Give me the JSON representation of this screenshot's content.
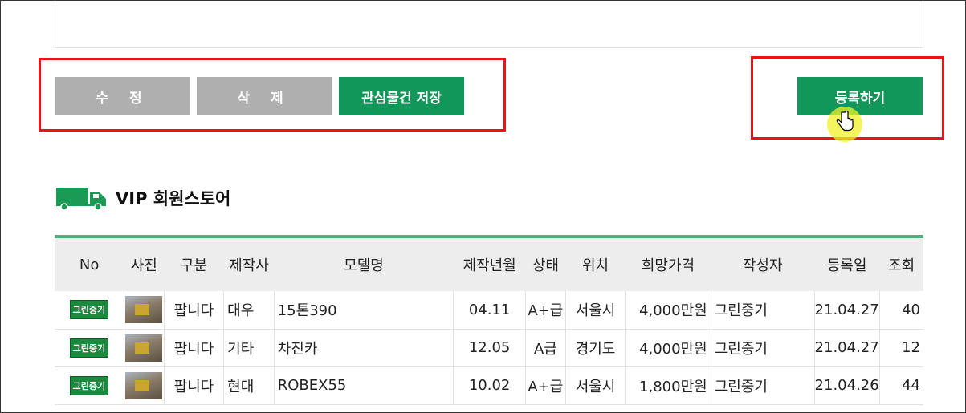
{
  "buttons": {
    "edit": "수 정",
    "delete": "삭 제",
    "save_interest": "관심물건 저장",
    "register": "등록하기"
  },
  "section": {
    "title": "VIP 회원스토어",
    "icon": "truck-icon"
  },
  "table": {
    "headers": [
      "No",
      "사진",
      "구분",
      "제작사",
      "모델명",
      "제작년월",
      "상태",
      "위치",
      "희망가격",
      "작성자",
      "등록일",
      "조회"
    ],
    "rows": [
      {
        "badge": "그린중기",
        "type": "팝니다",
        "maker": "대우",
        "model": "15톤390",
        "date": "04.11",
        "state": "A+급",
        "location": "서울시",
        "price": "4,000만원",
        "author": "그린중기",
        "reg": "21.04.27",
        "views": "40"
      },
      {
        "badge": "그린중기",
        "type": "팝니다",
        "maker": "기타",
        "model": "차진카",
        "date": "12.05",
        "state": "A급",
        "location": "경기도",
        "price": "4,000만원",
        "author": "그린중기",
        "reg": "21.04.27",
        "views": "12"
      },
      {
        "badge": "그린중기",
        "type": "팝니다",
        "maker": "현대",
        "model": "ROBEX55",
        "date": "10.02",
        "state": "A+급",
        "location": "서울시",
        "price": "1,800만원",
        "author": "그린중기",
        "reg": "21.04.26",
        "views": "44"
      }
    ]
  },
  "colors": {
    "accent_green": "#12975a",
    "button_gray": "#afafaf",
    "highlight_red": "#e11111"
  }
}
